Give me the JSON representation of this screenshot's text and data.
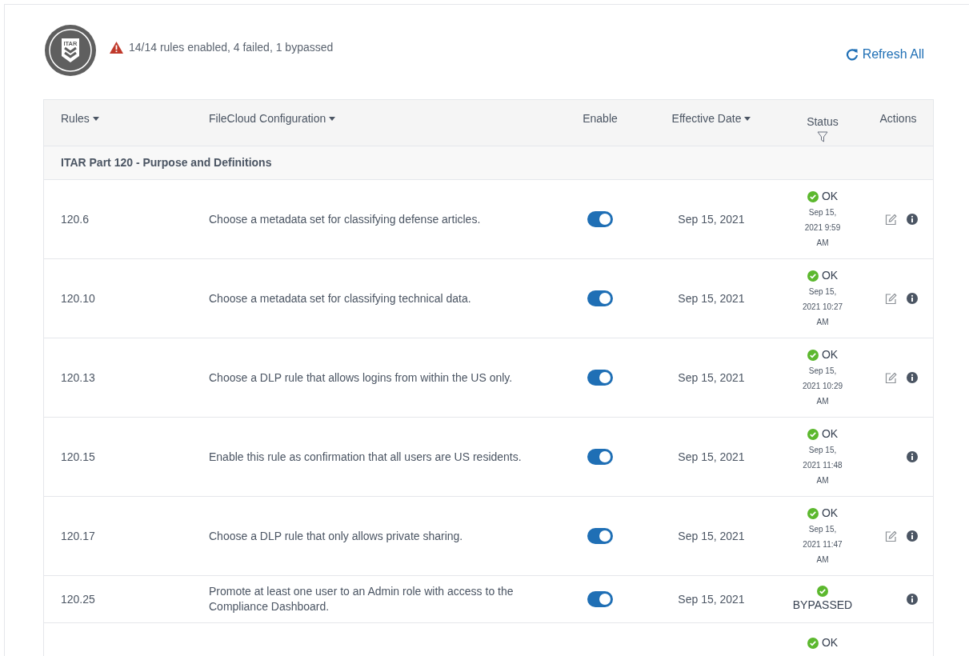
{
  "summary": {
    "badge_text": "ITAR",
    "message": "14/14 rules enabled, 4 failed, 1 bypassed"
  },
  "refresh_button": {
    "label": "Refresh All"
  },
  "table": {
    "columns": [
      {
        "label": "Rules",
        "sortable": true
      },
      {
        "label": "FileCloud Configuration",
        "sortable": true
      },
      {
        "label": "Enable",
        "sortable": false
      },
      {
        "label": "Effective Date",
        "sortable": true
      },
      {
        "label": "Status",
        "filter": true
      },
      {
        "label": "Actions"
      }
    ],
    "group": "ITAR Part 120 - Purpose and Definitions",
    "rows": [
      {
        "rule": "120.6",
        "configuration": "Choose a metadata set for classifying defense articles.",
        "enabled": true,
        "effective_date": "Sep 15, 2021",
        "status": {
          "kind": "ok",
          "label": "OK",
          "time": [
            "Sep 15,",
            "2021 9:59",
            "AM"
          ]
        },
        "editable": true
      },
      {
        "rule": "120.10",
        "configuration": "Choose a metadata set for classifying technical data.",
        "enabled": true,
        "effective_date": "Sep 15, 2021",
        "status": {
          "kind": "ok",
          "label": "OK",
          "time": [
            "Sep 15,",
            "2021 10:27",
            "AM"
          ]
        },
        "editable": true
      },
      {
        "rule": "120.13",
        "configuration": "Choose a DLP rule that allows logins from within the US only.",
        "enabled": true,
        "effective_date": "Sep 15, 2021",
        "status": {
          "kind": "ok",
          "label": "OK",
          "time": [
            "Sep 15,",
            "2021 10:29",
            "AM"
          ]
        },
        "editable": true
      },
      {
        "rule": "120.15",
        "configuration": "Enable this rule as confirmation that all users are US residents.",
        "enabled": true,
        "effective_date": "Sep 15, 2021",
        "status": {
          "kind": "ok",
          "label": "OK",
          "time": [
            "Sep 15,",
            "2021 11:48",
            "AM"
          ]
        },
        "editable": false
      },
      {
        "rule": "120.17",
        "configuration": "Choose a DLP rule that only allows private sharing.",
        "enabled": true,
        "effective_date": "Sep 15, 2021",
        "status": {
          "kind": "ok",
          "label": "OK",
          "time": [
            "Sep 15,",
            "2021 11:47",
            "AM"
          ]
        },
        "editable": true
      },
      {
        "rule": "120.25",
        "configuration": "Promote at least one user to an Admin role with access to the Compliance Dashboard.",
        "enabled": true,
        "effective_date": "Sep 15, 2021",
        "status": {
          "kind": "bypassed",
          "label": "BYPASSED"
        },
        "editable": false
      },
      {
        "status": {
          "kind": "ok",
          "label": "OK"
        }
      }
    ]
  }
}
